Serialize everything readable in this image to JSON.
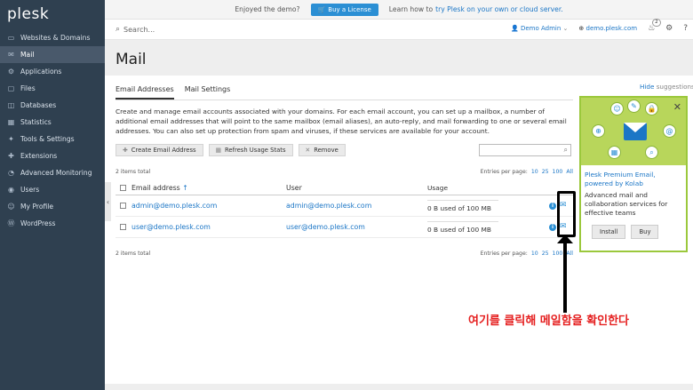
{
  "sidebar": {
    "logo": "plesk",
    "items": [
      {
        "label": "Websites & Domains",
        "icon": "monitor-icon",
        "glyph": "▭"
      },
      {
        "label": "Mail",
        "icon": "mail-icon",
        "glyph": "✉",
        "active": true
      },
      {
        "label": "Applications",
        "icon": "gear-icon",
        "glyph": "⚙"
      },
      {
        "label": "Files",
        "icon": "folder-icon",
        "glyph": "▢"
      },
      {
        "label": "Databases",
        "icon": "database-icon",
        "glyph": "◫"
      },
      {
        "label": "Statistics",
        "icon": "chart-icon",
        "glyph": "▦"
      },
      {
        "label": "Tools & Settings",
        "icon": "tools-icon",
        "glyph": "✦"
      },
      {
        "label": "Extensions",
        "icon": "puzzle-icon",
        "glyph": "✚"
      },
      {
        "label": "Advanced Monitoring",
        "icon": "monitoring-icon",
        "glyph": "◔"
      },
      {
        "label": "Users",
        "icon": "user-icon",
        "glyph": "◉"
      },
      {
        "label": "My Profile",
        "icon": "profile-icon",
        "glyph": "☺"
      },
      {
        "label": "WordPress",
        "icon": "wordpress-icon",
        "glyph": "Ⓦ"
      }
    ]
  },
  "topbar": {
    "enjoyed": "Enjoyed the demo?",
    "buy_label": "Buy a License",
    "learn_prefix": "Learn how to",
    "learn_link": "try Plesk on your own or cloud server."
  },
  "header": {
    "search_placeholder": "Search...",
    "user": "Demo Admin",
    "domain": "demo.plesk.com",
    "notification_count": "2"
  },
  "page": {
    "title": "Mail",
    "tabs": [
      {
        "label": "Email Addresses",
        "active": true
      },
      {
        "label": "Mail Settings",
        "active": false
      }
    ],
    "description": "Create and manage email accounts associated with your domains. For each email account, you can set up a mailbox, a number of additional email addresses that will point to the same mailbox (email aliases), an auto-reply, and mail forwarding to one or several email addresses. You can also set up protection from spam and viruses, if these services are available for your account."
  },
  "toolbar": {
    "create": "Create Email Address",
    "refresh": "Refresh Usage Stats",
    "remove": "Remove"
  },
  "list": {
    "total": "2 items total",
    "entries_label": "Entries per page:",
    "entries_options": [
      "10",
      "25",
      "100",
      "All"
    ],
    "columns": {
      "email": "Email address",
      "user": "User",
      "usage": "Usage"
    },
    "rows": [
      {
        "email": "admin@demo.plesk.com",
        "user": "admin@demo.plesk.com",
        "usage": "0 B used of 100 MB"
      },
      {
        "email": "user@demo.plesk.com",
        "user": "user@demo.plesk.com",
        "usage": "0 B used of 100 MB"
      }
    ]
  },
  "promo": {
    "hide": "Hide",
    "suggestions": "suggestions",
    "title": "Plesk Premium Email, powered by Kolab",
    "desc": "Advanced mail and collaboration services for effective teams",
    "install": "Install",
    "buy": "Buy"
  },
  "annotation": "여기를 클릭해 메일함을 확인한다"
}
